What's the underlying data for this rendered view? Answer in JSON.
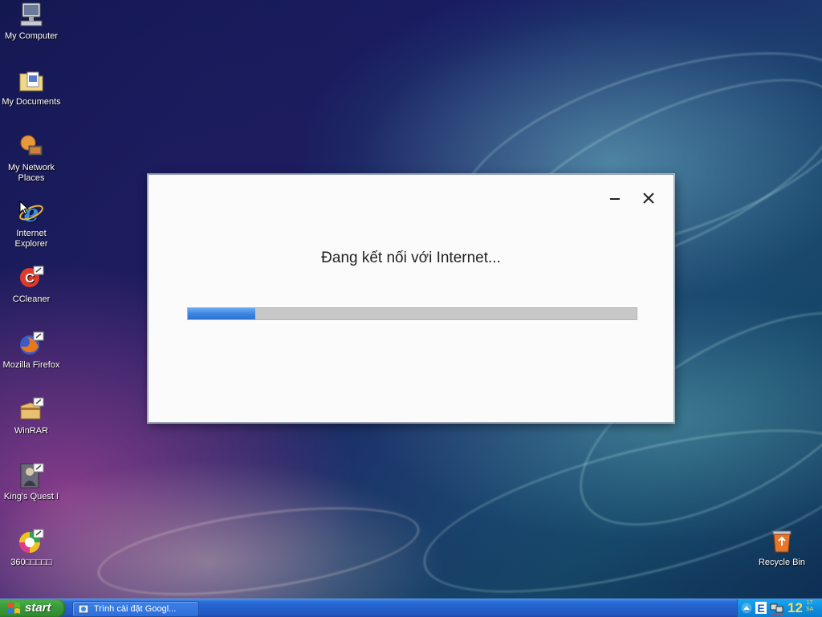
{
  "desktop": {
    "icons": [
      {
        "label": "My Computer"
      },
      {
        "label": "My Documents"
      },
      {
        "label": "My Network Places"
      },
      {
        "label": "Internet Explorer"
      },
      {
        "label": "CCleaner"
      },
      {
        "label": "Mozilla Firefox"
      },
      {
        "label": "WinRAR"
      },
      {
        "label": "King's Quest I"
      },
      {
        "label": "360□□□□□"
      },
      {
        "label": "Recycle Bin"
      }
    ]
  },
  "dialog": {
    "message": "Đang kết nối với Internet...",
    "progress_fraction": 0.15,
    "progress_color": "#3a82e0"
  },
  "taskbar": {
    "start_label": "start",
    "task_items": [
      {
        "label": "Trình cài đặt Googl..."
      }
    ],
    "clock": "12",
    "clock_minutes": "17",
    "clock_period": "SA"
  }
}
